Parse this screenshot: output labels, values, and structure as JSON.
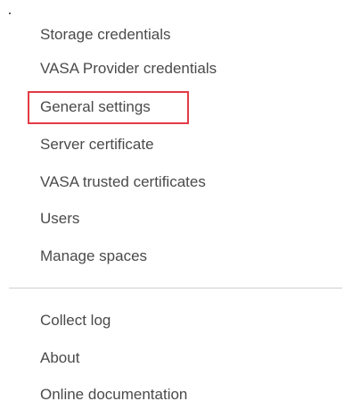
{
  "menu": {
    "section_top": {
      "items": [
        {
          "label": "Storage credentials"
        },
        {
          "label": "VASA Provider credentials"
        },
        {
          "label": "General settings",
          "highlighted": true
        },
        {
          "label": "Server certificate"
        },
        {
          "label": "VASA trusted certificates"
        },
        {
          "label": "Users"
        },
        {
          "label": "Manage spaces"
        }
      ]
    },
    "section_bottom": {
      "items": [
        {
          "label": "Collect log"
        },
        {
          "label": "About"
        },
        {
          "label": "Online documentation"
        }
      ]
    }
  },
  "colors": {
    "text": "#4a4a4a",
    "highlight_border": "#e33b46",
    "divider": "#cfcfcf",
    "background": "#ffffff"
  }
}
